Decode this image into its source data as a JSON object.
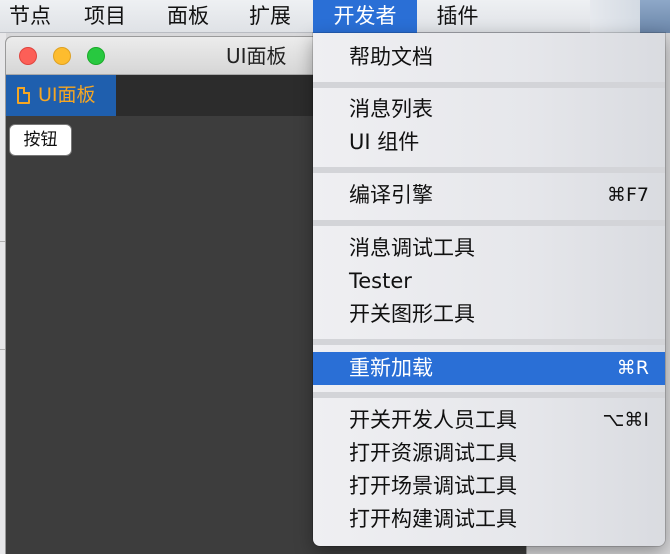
{
  "menubar": {
    "items": [
      {
        "label": "节点"
      },
      {
        "label": "项目"
      },
      {
        "label": "面板"
      },
      {
        "label": "扩展"
      },
      {
        "label": "开发者"
      },
      {
        "label": "插件"
      }
    ]
  },
  "window": {
    "title": "UI面板",
    "tab_label": "UI面板",
    "button_label": "按钮"
  },
  "dropdown": {
    "items": [
      {
        "label": "帮助文档",
        "shortcut": ""
      },
      {
        "label": "消息列表",
        "shortcut": ""
      },
      {
        "label": "UI 组件",
        "shortcut": ""
      },
      {
        "label": "编译引擎",
        "shortcut": "⌘F7"
      },
      {
        "label": "消息调试工具",
        "shortcut": ""
      },
      {
        "label": "Tester",
        "shortcut": ""
      },
      {
        "label": "开关图形工具",
        "shortcut": ""
      },
      {
        "label": "重新加载",
        "shortcut": "⌘R"
      },
      {
        "label": "开关开发人员工具",
        "shortcut": "⌥⌘I"
      },
      {
        "label": "打开资源调试工具",
        "shortcut": ""
      },
      {
        "label": "打开场景调试工具",
        "shortcut": ""
      },
      {
        "label": "打开构建调试工具",
        "shortcut": ""
      }
    ]
  },
  "colors": {
    "highlight": "#2a6fd6",
    "tab_bg": "#1f5fae",
    "tab_text": "#f5a623"
  }
}
